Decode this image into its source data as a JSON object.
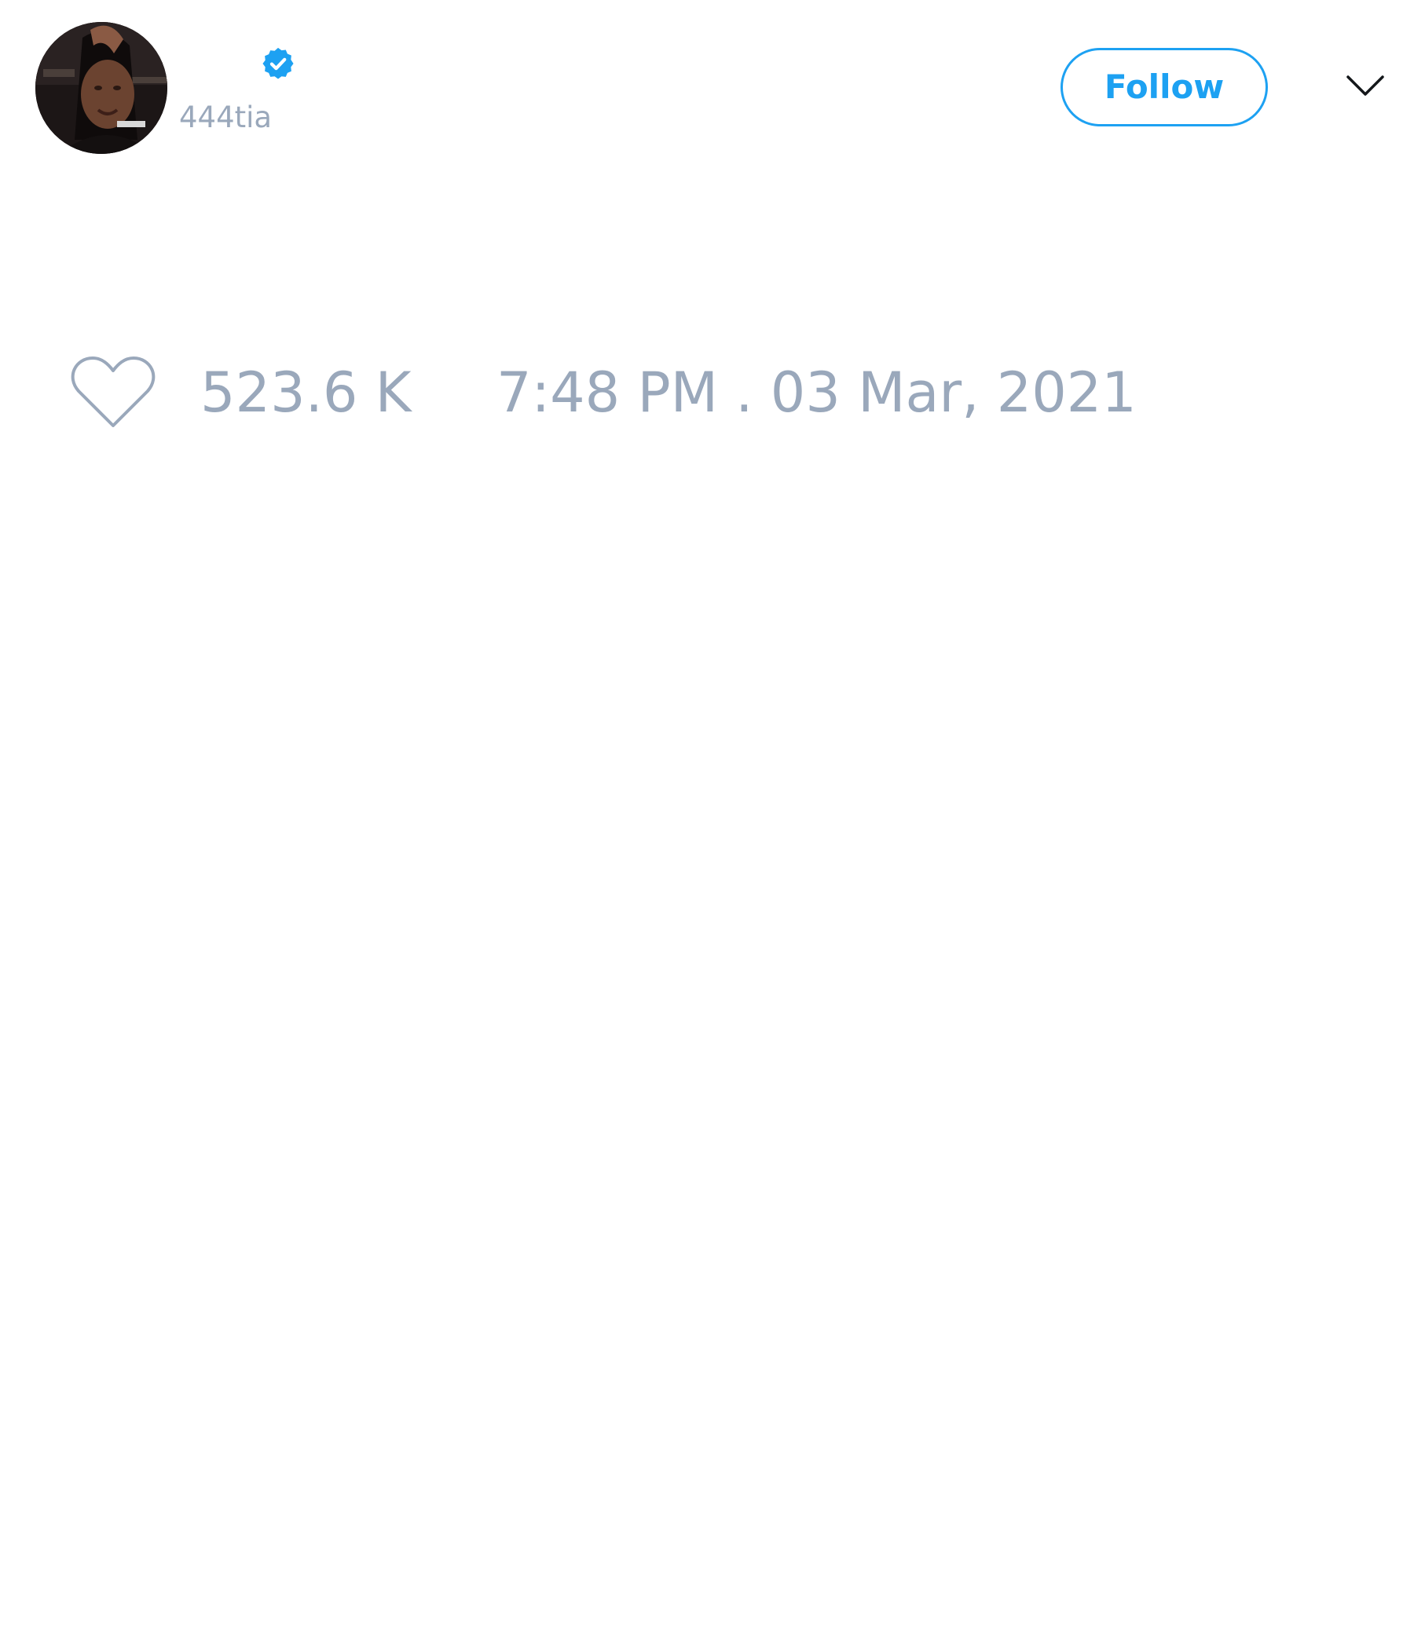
{
  "tweet": {
    "author": {
      "display_name": "",
      "handle": "444tia",
      "verified": true,
      "avatar_icon": "profile-photo"
    },
    "follow_button_label": "Follow",
    "menu_icon": "chevron-down-icon",
    "likes": {
      "icon": "heart-icon",
      "count": "523.6 K"
    },
    "timestamp": "7:48 PM . 03 Mar, 2021"
  },
  "colors": {
    "accent": "#1da1f2",
    "muted_text": "#9aa8bb",
    "background": "#ffffff"
  }
}
